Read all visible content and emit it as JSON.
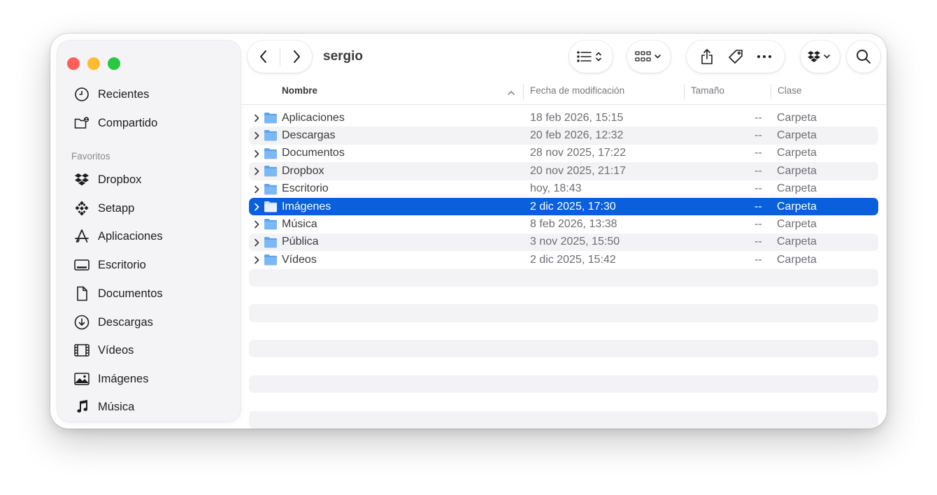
{
  "window": {
    "title": "sergio"
  },
  "sidebar": {
    "top_items": [
      {
        "label": "Recientes",
        "icon": "clock-icon"
      },
      {
        "label": "Compartido",
        "icon": "shared-folder-icon"
      }
    ],
    "section_label": "Favoritos",
    "favorites": [
      {
        "label": "Dropbox",
        "icon": "dropbox-icon"
      },
      {
        "label": "Setapp",
        "icon": "setapp-icon"
      },
      {
        "label": "Aplicaciones",
        "icon": "applications-icon"
      },
      {
        "label": "Escritorio",
        "icon": "desktop-icon"
      },
      {
        "label": "Documentos",
        "icon": "document-icon"
      },
      {
        "label": "Descargas",
        "icon": "download-icon"
      },
      {
        "label": "Vídeos",
        "icon": "film-icon"
      },
      {
        "label": "Imágenes",
        "icon": "photo-icon"
      },
      {
        "label": "Música",
        "icon": "music-note-icon"
      }
    ]
  },
  "toolbar": {
    "icons": [
      "back-icon",
      "forward-icon",
      "list-view-icon",
      "group-icon",
      "share-icon",
      "tag-icon",
      "more-icon",
      "dropbox-icon",
      "search-icon"
    ]
  },
  "columns": {
    "name": "Nombre",
    "date": "Fecha de modificación",
    "size": "Tamaño",
    "kind": "Clase",
    "sort_indicator": "ascending"
  },
  "files": [
    {
      "name": "Aplicaciones",
      "date": "18 feb 2026, 15:15",
      "size": "--",
      "kind": "Carpeta",
      "selected": false
    },
    {
      "name": "Descargas",
      "date": "20 feb 2026, 12:32",
      "size": "--",
      "kind": "Carpeta",
      "selected": false
    },
    {
      "name": "Documentos",
      "date": "28 nov 2025, 17:22",
      "size": "--",
      "kind": "Carpeta",
      "selected": false
    },
    {
      "name": "Dropbox",
      "date": "20 nov 2025, 21:17",
      "size": "--",
      "kind": "Carpeta",
      "selected": false
    },
    {
      "name": "Escritorio",
      "date": "hoy, 18:43",
      "size": "--",
      "kind": "Carpeta",
      "selected": false
    },
    {
      "name": "Imágenes",
      "date": "2 dic 2025, 17:30",
      "size": "--",
      "kind": "Carpeta",
      "selected": true
    },
    {
      "name": "Música",
      "date": "8 feb 2026, 13:38",
      "size": "--",
      "kind": "Carpeta",
      "selected": false
    },
    {
      "name": "Pública",
      "date": "3 nov 2025, 15:50",
      "size": "--",
      "kind": "Carpeta",
      "selected": false
    },
    {
      "name": "Vídeos",
      "date": "2 dic 2025, 15:42",
      "size": "--",
      "kind": "Carpeta",
      "selected": false
    }
  ],
  "colors": {
    "selection": "#0a60dc",
    "folder": "#5ea4ec",
    "close": "#ff5f57",
    "minimize": "#febc2e",
    "maximize": "#28c840"
  }
}
